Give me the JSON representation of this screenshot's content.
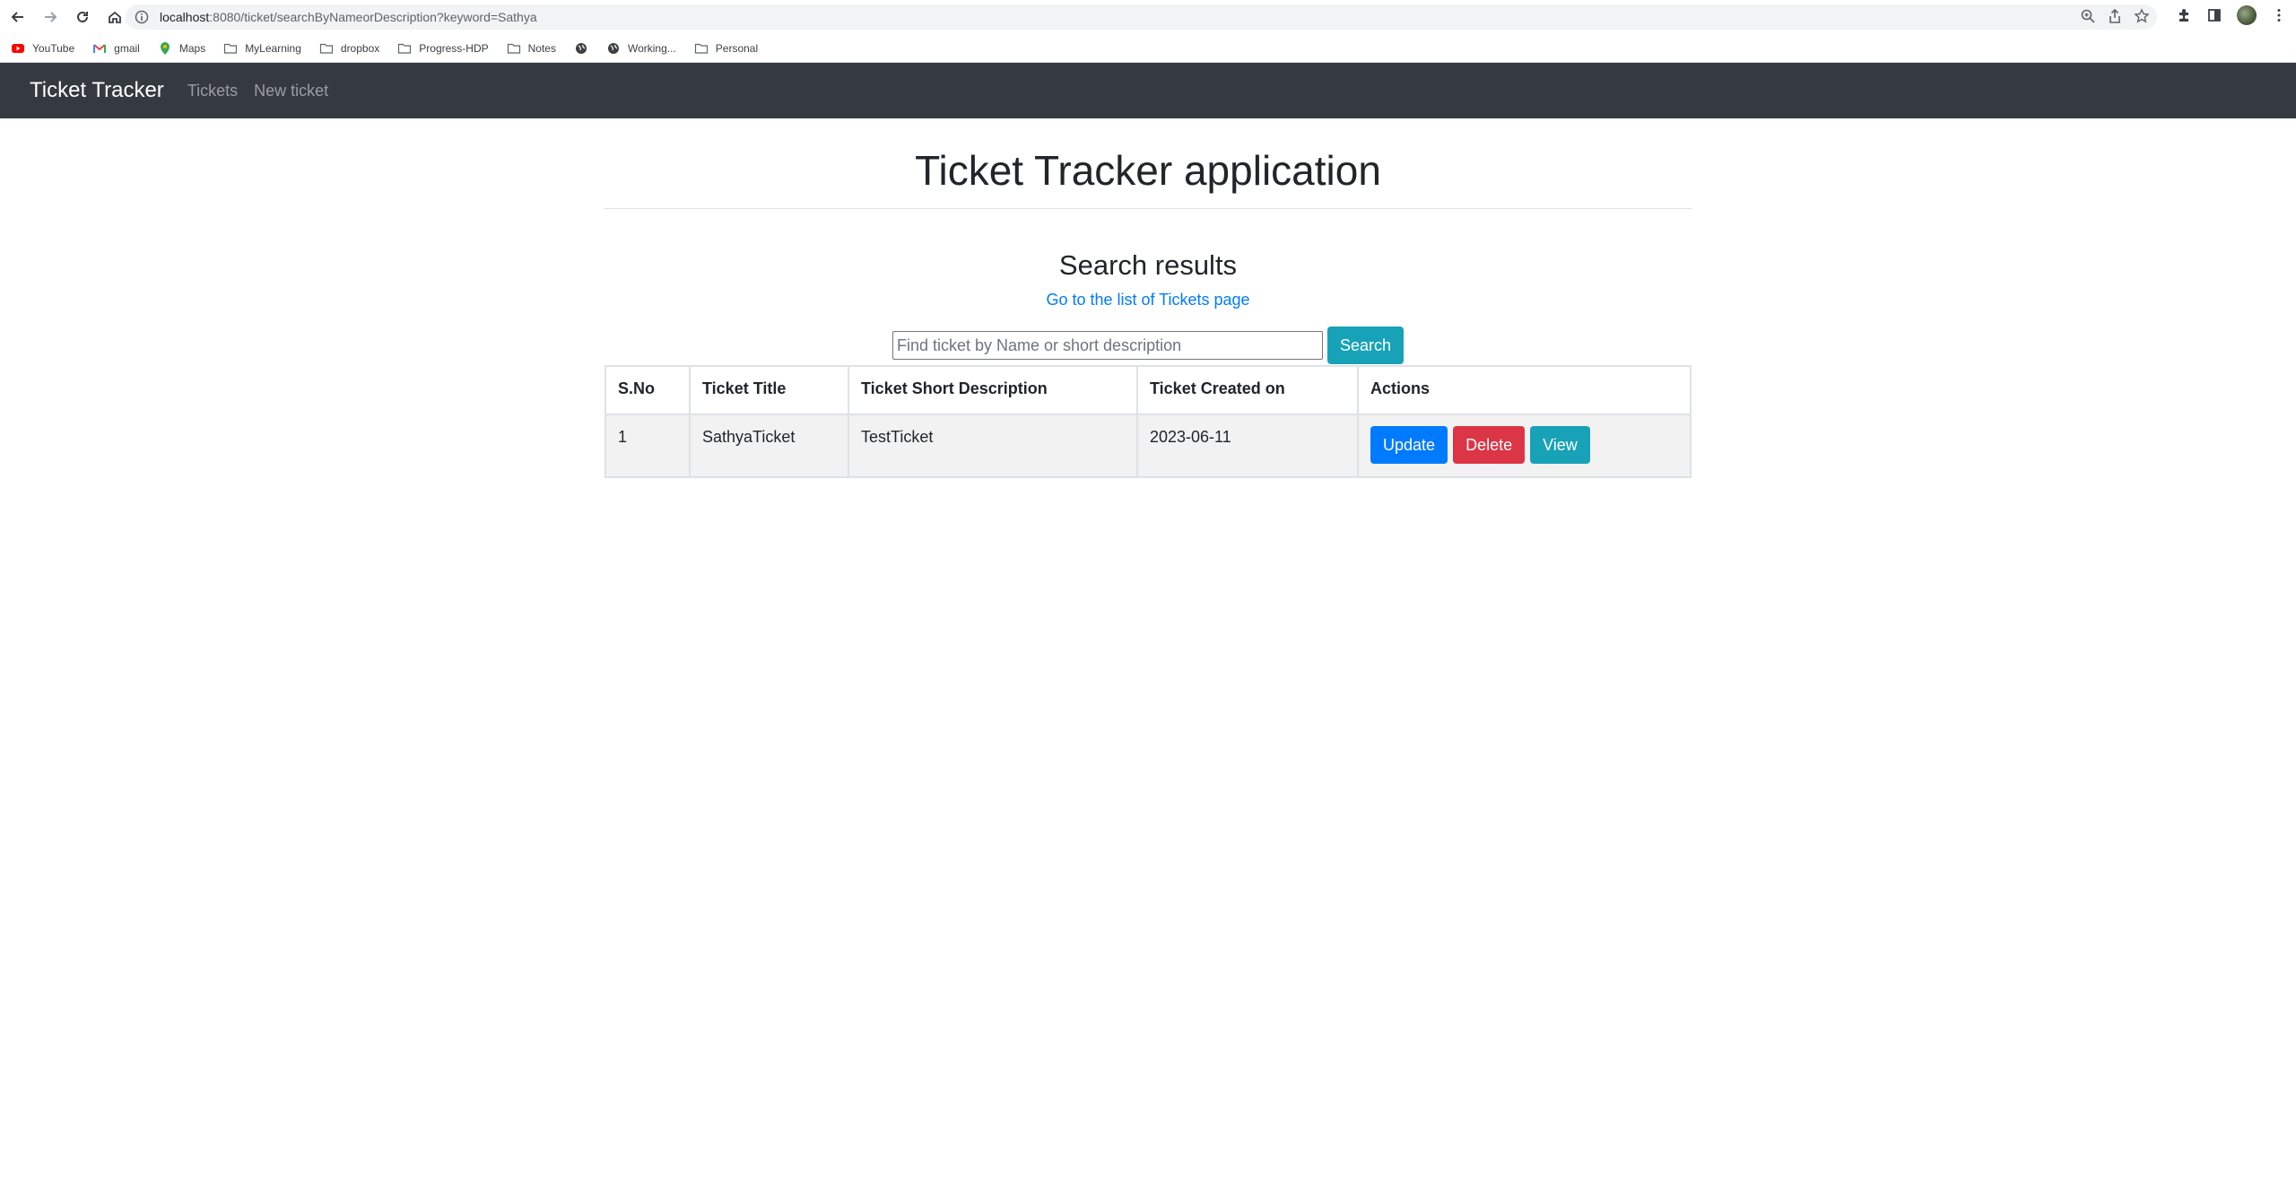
{
  "browser": {
    "url_host": "localhost",
    "url_rest": ":8080/ticket/searchByNameorDescription?keyword=Sathya",
    "bookmarks": [
      {
        "label": "YouTube",
        "icon": "youtube-icon"
      },
      {
        "label": "gmail",
        "icon": "gmail-icon"
      },
      {
        "label": "Maps",
        "icon": "maps-pin-icon"
      },
      {
        "label": "MyLearning",
        "icon": "folder-icon"
      },
      {
        "label": "dropbox",
        "icon": "folder-icon"
      },
      {
        "label": "Progress-HDP",
        "icon": "folder-icon"
      },
      {
        "label": "Notes",
        "icon": "folder-icon"
      },
      {
        "label": "",
        "icon": "globe-icon"
      },
      {
        "label": "Working...",
        "icon": "globe-icon"
      },
      {
        "label": "Personal",
        "icon": "folder-icon"
      }
    ]
  },
  "navbar": {
    "brand": "Ticket Tracker",
    "links": [
      "Tickets",
      "New ticket"
    ]
  },
  "main": {
    "title": "Ticket Tracker application",
    "results_heading": "Search results",
    "back_link": "Go to the list of Tickets page",
    "search": {
      "placeholder": "Find ticket by Name or short description",
      "value": "",
      "button": "Search"
    },
    "table": {
      "headers": [
        "S.No",
        "Ticket Title",
        "Ticket Short Description",
        "Ticket Created on",
        "Actions"
      ],
      "rows": [
        {
          "sno": "1",
          "title": "SathyaTicket",
          "description": "TestTicket",
          "created_on": "2023-06-11",
          "actions": [
            "Update",
            "Delete",
            "View"
          ]
        }
      ]
    }
  },
  "colors": {
    "navbar_bg": "#343a40",
    "primary": "#007bff",
    "danger": "#dc3545",
    "info": "#17a2b8"
  }
}
